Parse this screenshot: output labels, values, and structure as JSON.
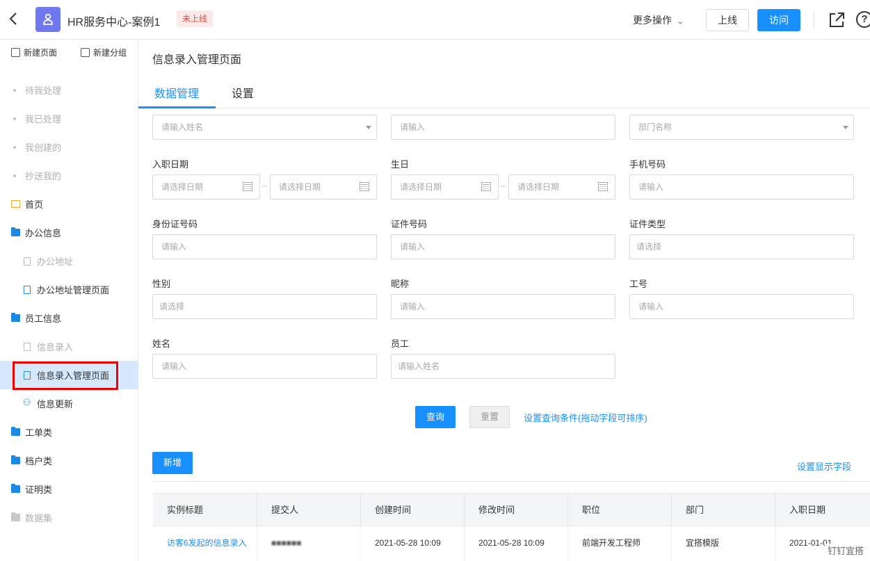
{
  "topbar": {
    "app_title": "HR服务中心-案例1",
    "status": "未上线",
    "more_ops": "更多操作",
    "online_button": "上线",
    "visit_button": "访问",
    "accent_color": "#1890ff",
    "status_color": "#e5483c"
  },
  "sidebar": {
    "new_page": "新建页面",
    "new_group": "新建分组",
    "items": [
      {
        "label": "待我处理"
      },
      {
        "label": "我已处理"
      },
      {
        "label": "我创建的"
      },
      {
        "label": "抄送我的"
      },
      {
        "label": "首页"
      },
      {
        "label": "办公信息"
      },
      {
        "label": "办公地址"
      },
      {
        "label": "办公地址管理页面"
      },
      {
        "label": "员工信息"
      },
      {
        "label": "信息录入"
      },
      {
        "label": "信息录入管理页面"
      },
      {
        "label": "信息更新"
      },
      {
        "label": "工单类"
      },
      {
        "label": "档户类"
      },
      {
        "label": "证明类"
      },
      {
        "label": "数据集"
      }
    ],
    "active_item": "信息录入管理页面"
  },
  "main": {
    "page_title": "信息录入管理页面",
    "tabs": [
      {
        "label": "数据管理"
      },
      {
        "label": "设置"
      }
    ],
    "filters": {
      "row0": {
        "name_select": "请输入姓名",
        "text_input": "请输入",
        "dept_select": "部门名称"
      },
      "hire_date": {
        "label": "入职日期",
        "start": "请选择日期",
        "end": "请选择日期"
      },
      "birthday": {
        "label": "生日",
        "start": "请选择日期",
        "end": "请选择日期"
      },
      "phone": {
        "label": "手机号码",
        "placeholder": "请输入"
      },
      "id_card": {
        "label": "身份证号码",
        "placeholder": "请输入"
      },
      "cert_no": {
        "label": "证件号码",
        "placeholder": "请输入"
      },
      "cert_type": {
        "label": "证件类型",
        "placeholder": "请选择"
      },
      "gender": {
        "label": "性别",
        "placeholder": "请选择"
      },
      "nickname": {
        "label": "昵称",
        "placeholder": "请输入"
      },
      "employee_no": {
        "label": "工号",
        "placeholder": "请输入"
      },
      "name": {
        "label": "姓名",
        "placeholder": "请输入"
      },
      "employee": {
        "label": "员工",
        "placeholder": "请输入姓名"
      }
    },
    "query_button": "查询",
    "reset_button": "重置",
    "condition_link": "设置查询条件(拖动字段可排序)",
    "new_button": "新增",
    "display_fields_link": "设置显示字段",
    "table": {
      "columns": [
        "实例标题",
        "提交人",
        "创建时间",
        "修改时间",
        "职位",
        "部门",
        "入职日期"
      ],
      "rows": [
        [
          "访客6发起的信息录入",
          "■■■■■■",
          "2021-05-28 10:09",
          "2021-05-28 10:09",
          "前端开发工程师",
          "宜搭模版",
          "2021-01-01"
        ]
      ]
    }
  },
  "watermark": "钉钉宜搭"
}
